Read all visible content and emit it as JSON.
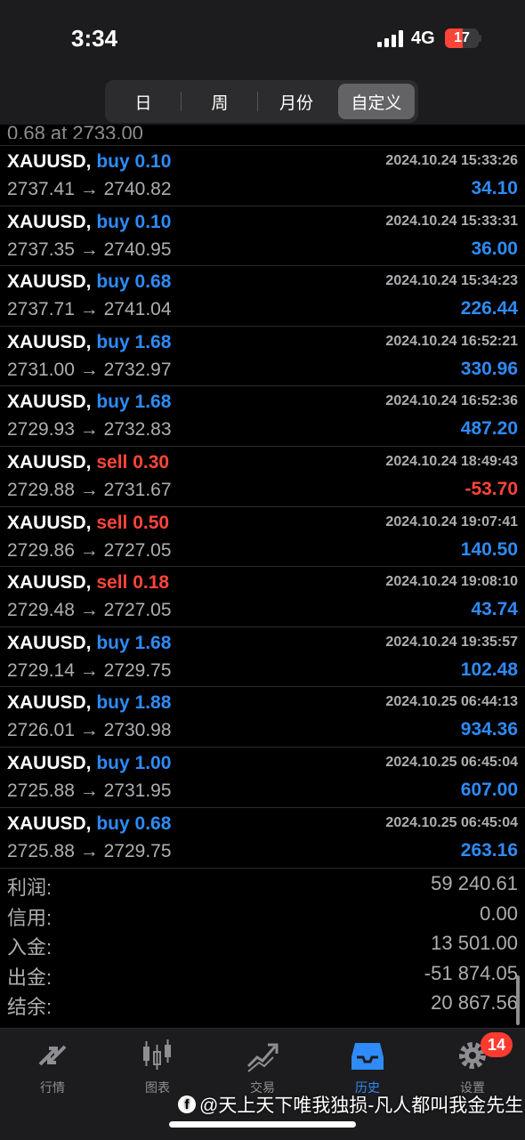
{
  "status_bar": {
    "time": "3:34",
    "network": "4G",
    "battery": "17"
  },
  "header": {
    "segments": [
      {
        "label": "日",
        "active": false
      },
      {
        "label": "周",
        "active": false
      },
      {
        "label": "月份",
        "active": false
      },
      {
        "label": "自定义",
        "active": true
      }
    ]
  },
  "partial_row_text": "0.68 at 2733.00",
  "deals": [
    {
      "symbol": "XAUUSD,",
      "side": "buy",
      "volume": "0.10",
      "datetime": "2024.10.24 15:33:26",
      "open": "2737.41",
      "close": "2740.82",
      "profit": "34.10"
    },
    {
      "symbol": "XAUUSD,",
      "side": "buy",
      "volume": "0.10",
      "datetime": "2024.10.24 15:33:31",
      "open": "2737.35",
      "close": "2740.95",
      "profit": "36.00"
    },
    {
      "symbol": "XAUUSD,",
      "side": "buy",
      "volume": "0.68",
      "datetime": "2024.10.24 15:34:23",
      "open": "2737.71",
      "close": "2741.04",
      "profit": "226.44"
    },
    {
      "symbol": "XAUUSD,",
      "side": "buy",
      "volume": "1.68",
      "datetime": "2024.10.24 16:52:21",
      "open": "2731.00",
      "close": "2732.97",
      "profit": "330.96"
    },
    {
      "symbol": "XAUUSD,",
      "side": "buy",
      "volume": "1.68",
      "datetime": "2024.10.24 16:52:36",
      "open": "2729.93",
      "close": "2732.83",
      "profit": "487.20"
    },
    {
      "symbol": "XAUUSD,",
      "side": "sell",
      "volume": "0.30",
      "datetime": "2024.10.24 18:49:43",
      "open": "2729.88",
      "close": "2731.67",
      "profit": "-53.70"
    },
    {
      "symbol": "XAUUSD,",
      "side": "sell",
      "volume": "0.50",
      "datetime": "2024.10.24 19:07:41",
      "open": "2729.86",
      "close": "2727.05",
      "profit": "140.50"
    },
    {
      "symbol": "XAUUSD,",
      "side": "sell",
      "volume": "0.18",
      "datetime": "2024.10.24 19:08:10",
      "open": "2729.48",
      "close": "2727.05",
      "profit": "43.74"
    },
    {
      "symbol": "XAUUSD,",
      "side": "buy",
      "volume": "1.68",
      "datetime": "2024.10.24 19:35:57",
      "open": "2729.14",
      "close": "2729.75",
      "profit": "102.48"
    },
    {
      "symbol": "XAUUSD,",
      "side": "buy",
      "volume": "1.88",
      "datetime": "2024.10.25 06:44:13",
      "open": "2726.01",
      "close": "2730.98",
      "profit": "934.36"
    },
    {
      "symbol": "XAUUSD,",
      "side": "buy",
      "volume": "1.00",
      "datetime": "2024.10.25 06:45:04",
      "open": "2725.88",
      "close": "2731.95",
      "profit": "607.00"
    },
    {
      "symbol": "XAUUSD,",
      "side": "buy",
      "volume": "0.68",
      "datetime": "2024.10.25 06:45:04",
      "open": "2725.88",
      "close": "2729.75",
      "profit": "263.16"
    }
  ],
  "summary": [
    {
      "label": "利润:",
      "value": "59 240.61"
    },
    {
      "label": "信用:",
      "value": "0.00"
    },
    {
      "label": "入金:",
      "value": "13 501.00"
    },
    {
      "label": "出金:",
      "value": "-51 874.05"
    },
    {
      "label": "结余:",
      "value": "20 867.56"
    }
  ],
  "tabs": [
    {
      "label": "行情",
      "icon": "quotes-arrows-icon",
      "active": false
    },
    {
      "label": "图表",
      "icon": "candlestick-chart-icon",
      "active": false
    },
    {
      "label": "交易",
      "icon": "trade-trend-icon",
      "active": false
    },
    {
      "label": "历史",
      "icon": "history-inbox-icon",
      "active": true
    },
    {
      "label": "设置",
      "icon": "gear-icon",
      "active": false
    }
  ],
  "settings_badge": "14",
  "watermark": "@天上天下唯我独损-凡人都叫我金先生",
  "colors": {
    "buy": "#2e8bf7",
    "sell": "#ff453a",
    "muted": "#aeaeb2",
    "active_tab": "#2e8bf7"
  }
}
